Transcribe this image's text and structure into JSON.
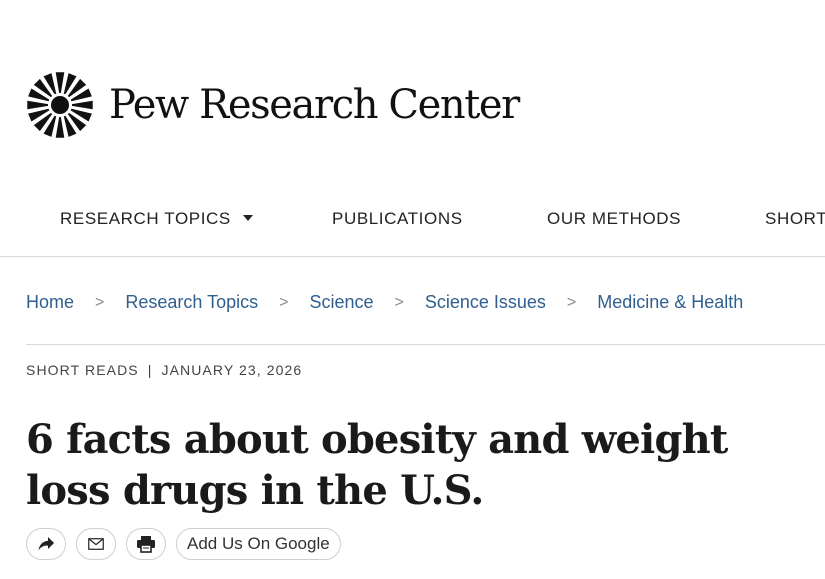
{
  "header": {
    "brand_name": "Pew Research Center",
    "logo_icon": "pew-sunburst-icon"
  },
  "nav": {
    "items": [
      {
        "label": "RESEARCH TOPICS",
        "has_dropdown": true
      },
      {
        "label": "PUBLICATIONS"
      },
      {
        "label": "OUR METHODS"
      },
      {
        "label": "SHORT"
      }
    ]
  },
  "breadcrumb": {
    "separator": ">",
    "items": [
      {
        "label": "Home"
      },
      {
        "label": "Research Topics"
      },
      {
        "label": "Science"
      },
      {
        "label": "Science Issues"
      },
      {
        "label": "Medicine & Health"
      }
    ]
  },
  "article": {
    "category": "SHORT READS",
    "meta_separator": "|",
    "date": "JANUARY 23, 2026",
    "title": "6 facts about obesity and weight loss drugs in the U.S."
  },
  "share": {
    "share_icon": "share-arrow-icon",
    "email_icon": "envelope-icon",
    "print_icon": "printer-icon",
    "google_label": "Add Us On Google"
  },
  "colors": {
    "link": "#2f5f8f",
    "text": "#1a1a1a",
    "border": "#d9d9d9"
  }
}
